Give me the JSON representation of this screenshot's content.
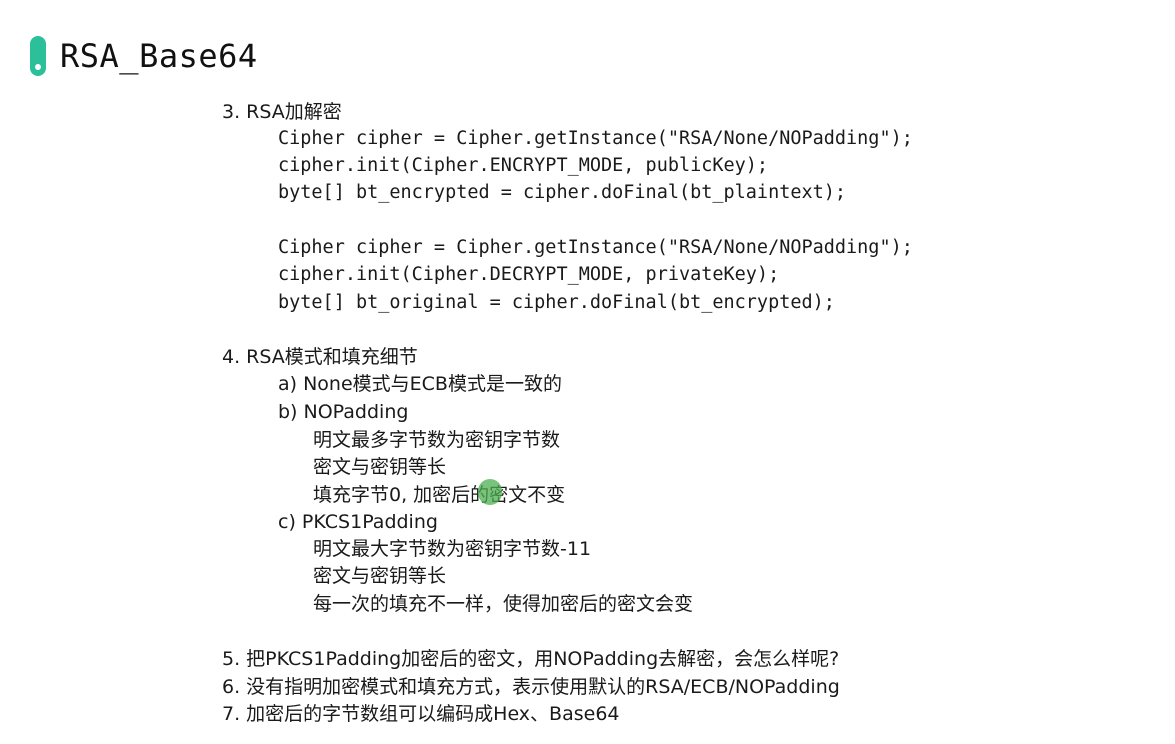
{
  "title": "RSA_Base64",
  "content": {
    "s3": {
      "heading": "3. RSA加解密",
      "code": [
        "Cipher cipher = Cipher.getInstance(\"RSA/None/NOPadding\");",
        "cipher.init(Cipher.ENCRYPT_MODE, publicKey);",
        "byte[] bt_encrypted = cipher.doFinal(bt_plaintext);",
        "Cipher cipher = Cipher.getInstance(\"RSA/None/NOPadding\");",
        "cipher.init(Cipher.DECRYPT_MODE, privateKey);",
        "byte[] bt_original = cipher.doFinal(bt_encrypted);"
      ]
    },
    "s4": {
      "heading": "4. RSA模式和填充细节",
      "a": "a) None模式与ECB模式是一致的",
      "b": "b) NOPadding",
      "b_items": [
        "明文最多字节数为密钥字节数",
        "密文与密钥等长",
        "填充字节0, 加密后的密文不变"
      ],
      "c": "c) PKCS1Padding",
      "c_items": [
        "明文最大字节数为密钥字节数-11",
        "密文与密钥等长",
        "每一次的填充不一样，使得加密后的密文会变"
      ]
    },
    "s5": "5. 把PKCS1Padding加密后的密文，用NOPadding去解密，会怎么样呢?",
    "s6": "6. 没有指明加密模式和填充方式，表示使用默认的RSA/ECB/NOPadding",
    "s7": "7. 加密后的字节数组可以编码成Hex、Base64"
  },
  "colors": {
    "accent": "#2bbf9a",
    "cursor": "#4caf50"
  }
}
